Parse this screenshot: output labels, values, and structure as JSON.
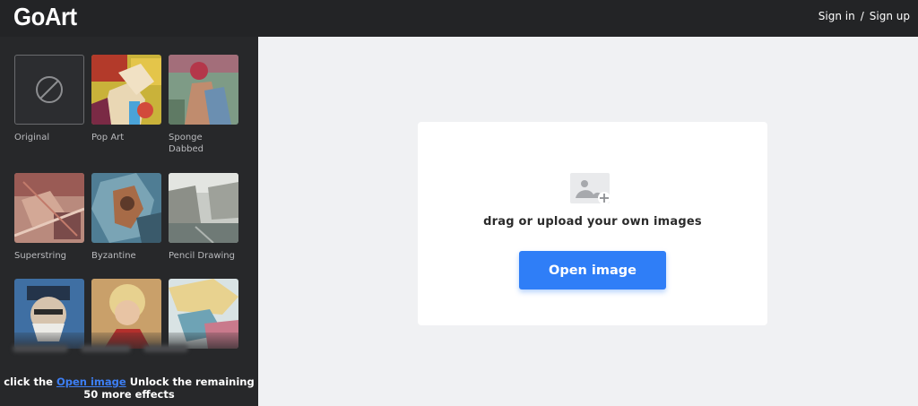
{
  "header": {
    "logo": "GoArt",
    "sign_in": "Sign in",
    "separator": "/",
    "sign_up": "Sign up"
  },
  "sidebar": {
    "effects": [
      {
        "label": "Original",
        "icon": "none-icon"
      },
      {
        "label": "Pop Art"
      },
      {
        "label": "Sponge Dabbed"
      },
      {
        "label": "Superstring"
      },
      {
        "label": "Byzantine"
      },
      {
        "label": "Pencil Drawing"
      },
      {
        "label": ""
      },
      {
        "label": ""
      },
      {
        "label": ""
      }
    ],
    "unlock_prefix": "click the",
    "unlock_link": "Open image",
    "unlock_suffix": "Unlock the remaining 50 more effects"
  },
  "upload": {
    "icon": "add-image-icon",
    "text": "drag or upload your own images",
    "button": "Open image"
  },
  "colors": {
    "topbar": "#232426",
    "sidebar": "#27282a",
    "accent": "#2f7ef7",
    "background": "#f0f1f3"
  }
}
